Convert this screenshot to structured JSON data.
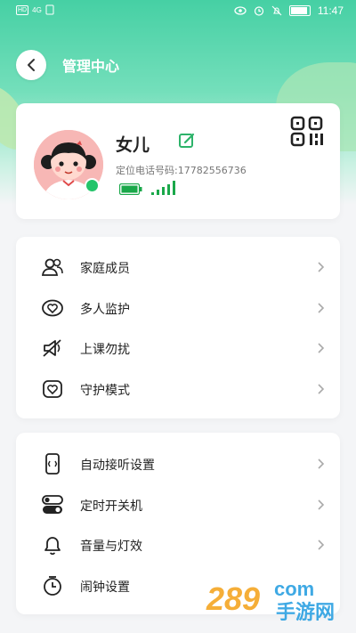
{
  "status": {
    "network": "4G",
    "time": "11:47"
  },
  "header": {
    "title": "管理中心"
  },
  "profile": {
    "name": "女儿",
    "phone_label": "定位电话号码:17782556736"
  },
  "menu1": [
    {
      "label": "家庭成员",
      "icon": "family-members-icon"
    },
    {
      "label": "多人监护",
      "icon": "heart-icon"
    },
    {
      "label": "上课勿扰",
      "icon": "mute-speaker-icon"
    },
    {
      "label": "守护模式",
      "icon": "heart-shield-icon"
    }
  ],
  "menu2": [
    {
      "label": "自动接听设置",
      "icon": "phone-auto-answer-icon"
    },
    {
      "label": "定时开关机",
      "icon": "toggle-switch-icon"
    },
    {
      "label": "音量与灯效",
      "icon": "bell-icon"
    },
    {
      "label": "闹钟设置",
      "icon": "alarm-clock-icon"
    }
  ],
  "watermark": {
    "brand": "289",
    "sub": "手游网",
    "suffix": "com"
  },
  "colors": {
    "accent": "#46d0a4",
    "online": "#25c46a",
    "battery": "#1aa84a"
  }
}
